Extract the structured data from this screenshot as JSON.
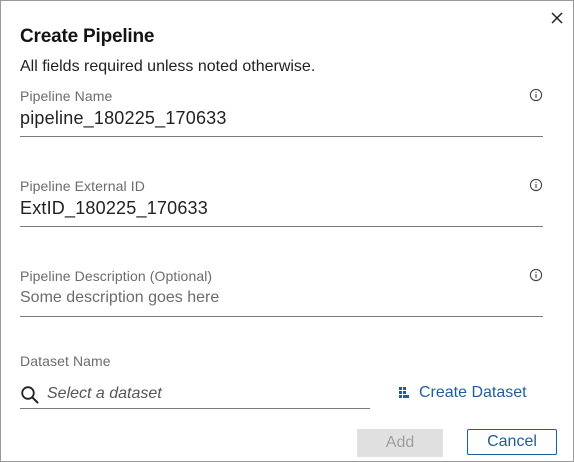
{
  "dialog": {
    "title": "Create Pipeline",
    "subtitle": "All fields required unless noted otherwise.",
    "close_icon": "close-icon"
  },
  "fields": {
    "pipeline_name": {
      "label": "Pipeline Name",
      "value": "pipeline_180225_170633",
      "info_icon": "info-icon"
    },
    "external_id": {
      "label": "Pipeline External ID",
      "value": "ExtID_180225_170633",
      "info_icon": "info-icon"
    },
    "description": {
      "label": "Pipeline Description (Optional)",
      "placeholder": "Some description goes here",
      "info_icon": "info-icon"
    },
    "dataset": {
      "label": "Dataset Name",
      "placeholder": "Select a dataset",
      "search_icon": "search-icon",
      "create_label": "Create Dataset",
      "create_icon": "dataset-icon"
    }
  },
  "buttons": {
    "add_label": "Add",
    "cancel_label": "Cancel"
  },
  "colors": {
    "accent": "#1f5e9c",
    "disabled_bg": "#e0e0e0",
    "disabled_text": "#9e9e9e",
    "underline": "#7a7a7a"
  }
}
